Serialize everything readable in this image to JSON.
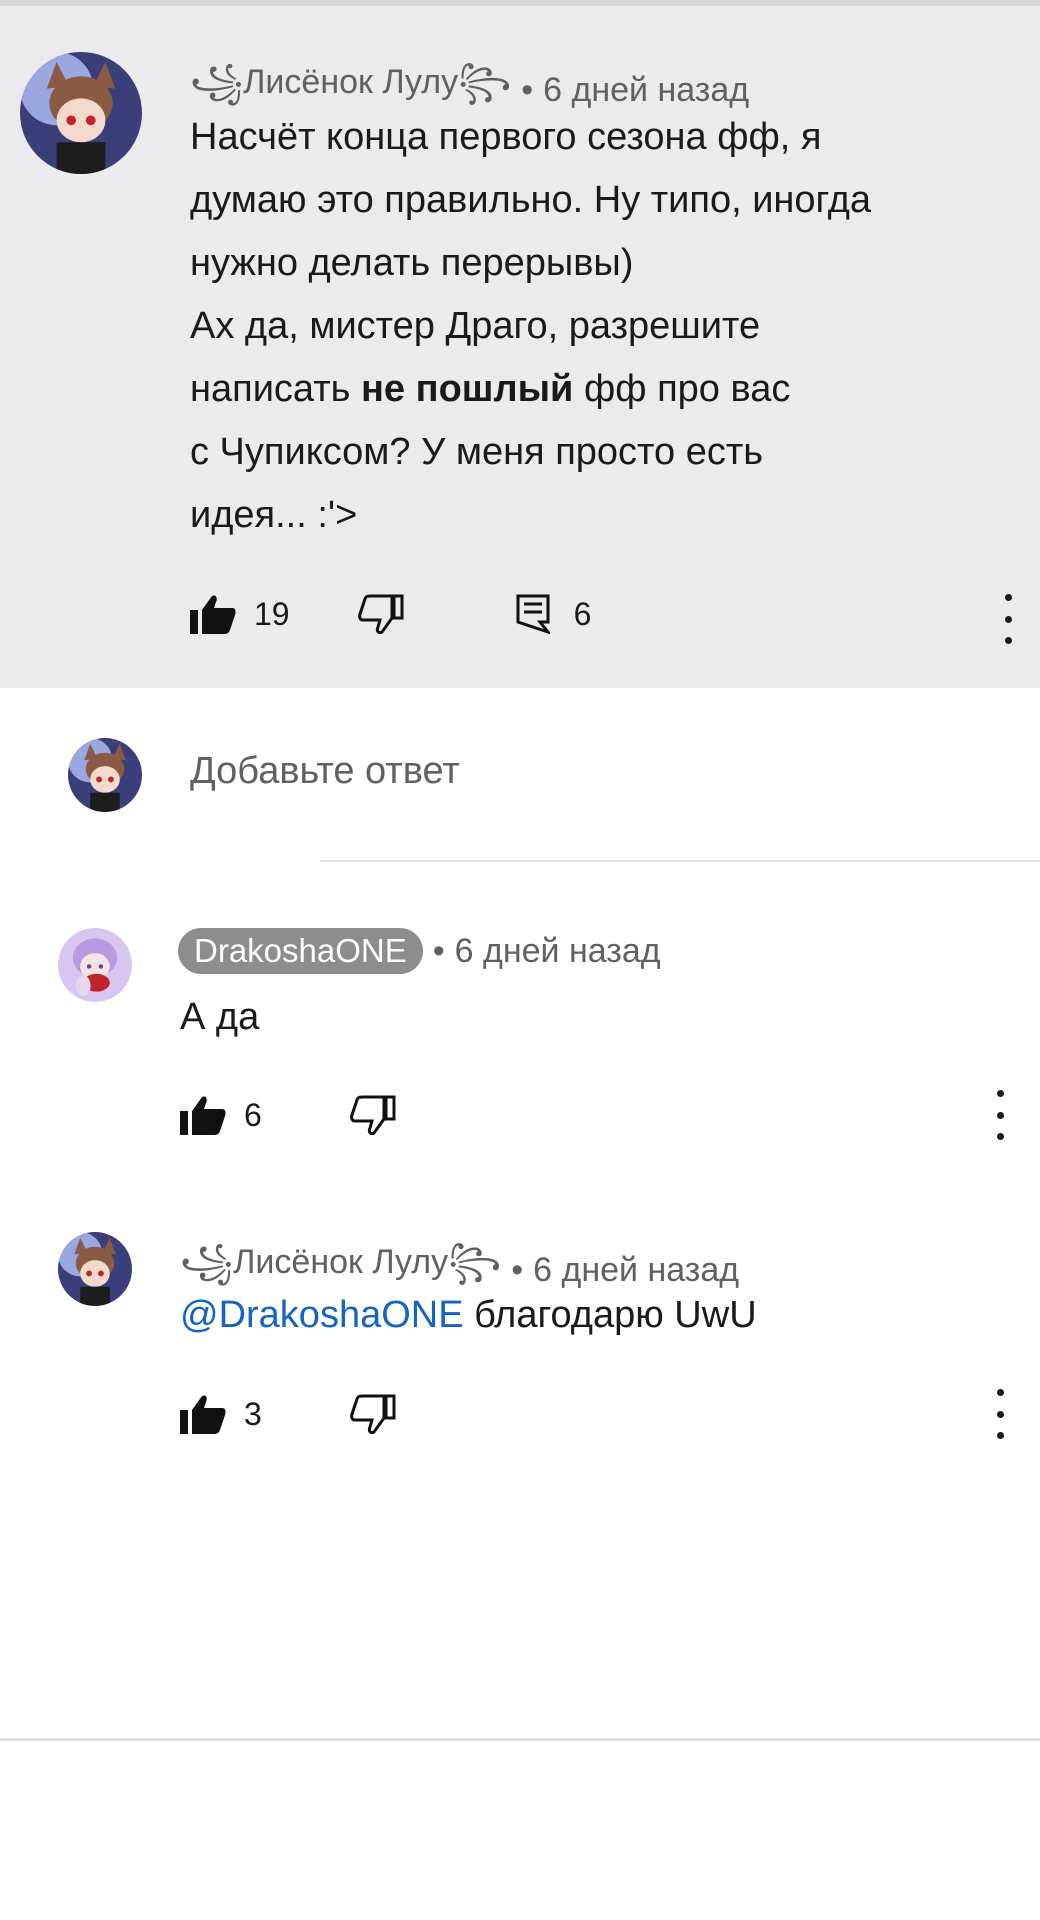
{
  "parent_comment": {
    "author": "꧁Лисёнок Лулу꧂",
    "separator": "•",
    "time": "6 дней назад",
    "lines": [
      "Насчёт конца первого сезона фф, я",
      "думаю это правильно. Ну типо, иногда",
      "нужно делать перерывы)",
      "Ах да, мистер Драго, разрешите"
    ],
    "line5_before": "написать ",
    "line5_bold": "не пошлый",
    "line5_after": " фф про вас",
    "line6": "с Чупиксом?  У меня просто есть",
    "line7": "идея...  :'>",
    "likes": "19",
    "replies": "6"
  },
  "reply_box": {
    "placeholder": "Добавьте ответ"
  },
  "replies": [
    {
      "author": "DrakoshaONE",
      "separator": "•",
      "time": "6 дней назад",
      "text": "А да",
      "likes": "6"
    },
    {
      "author": "꧁Лисёнок Лулу꧂",
      "separator": "•",
      "time": "6 дней назад",
      "mention": "@DrakoshaONE",
      "text": " благодарю UwU",
      "likes": "3"
    }
  ],
  "colors": {
    "parent_background": "#ebebef",
    "mention": "#1565c0",
    "author_chip": "#8d8d8d"
  },
  "icons": [
    "thumb-up-icon",
    "thumb-down-icon",
    "reply-icon",
    "more-vert-icon"
  ]
}
